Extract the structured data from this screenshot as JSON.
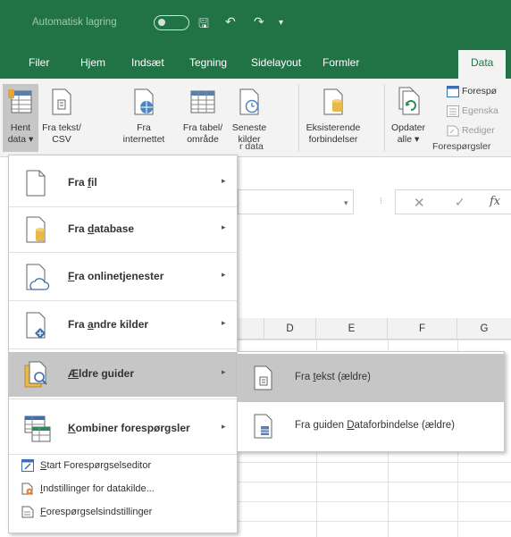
{
  "titlebar": {
    "autosave_label": "Automatisk lagring",
    "save_glyph": "🖫",
    "undo_glyph": "↶",
    "redo_glyph": "↷",
    "more_glyph": "▾"
  },
  "tabs": [
    {
      "label": "Filer"
    },
    {
      "label": "Hjem"
    },
    {
      "label": "Indsæt"
    },
    {
      "label": "Tegning"
    },
    {
      "label": "Sidelayout"
    },
    {
      "label": "Formler"
    },
    {
      "label": "Data"
    }
  ],
  "ribbon": {
    "hent_data": {
      "line1": "Hent",
      "line2": "data ▾"
    },
    "fra_tekst": {
      "line1": "Fra tekst/",
      "line2": "CSV"
    },
    "fra_internettet": {
      "line1": "Fra",
      "line2": "internettet"
    },
    "fra_tabel": {
      "line1": "Fra tabel/",
      "line2": "område"
    },
    "seneste_kilder": {
      "line1": "Seneste",
      "line2": "kilder"
    },
    "eksisterende": {
      "line1": "Eksisterende",
      "line2": "forbindelser"
    },
    "opdater": {
      "line1": "Opdater",
      "line2": "alle ▾"
    },
    "foresp": "Forespø",
    "egenska": "Egenska",
    "rediger": "Rediger",
    "group_data_label": "r data",
    "group_foresp_label": "Forespørgsler"
  },
  "formula_bar": {
    "dropdown": "▾",
    "cancel": "✕",
    "enter": "✓",
    "fx": "fx"
  },
  "columns": [
    "D",
    "E",
    "F",
    "G"
  ],
  "menu": {
    "items": [
      {
        "pre": "Fra ",
        "key": "f",
        "post": "il"
      },
      {
        "pre": "Fra ",
        "key": "d",
        "post": "atabase"
      },
      {
        "pre": "",
        "key": "F",
        "post": "ra onlinetjenester"
      },
      {
        "pre": "Fra ",
        "key": "a",
        "post": "ndre kilder"
      },
      {
        "pre": "",
        "key": "Æ",
        "post": "ldre guider"
      },
      {
        "pre": "",
        "key": "K",
        "post": "ombiner forespørgsler"
      }
    ],
    "small_items": [
      {
        "key": "S",
        "post": "tart Forespørgselseditor"
      },
      {
        "key": "I",
        "post": "ndstillinger for datakilde..."
      },
      {
        "key": "F",
        "post": "orespørgselsindstillinger"
      }
    ],
    "arrow": "▸"
  },
  "submenu": {
    "items": [
      {
        "pre": "Fra ",
        "key": "t",
        "post": "ekst (ældre)"
      },
      {
        "pre": "Fra guiden ",
        "key": "D",
        "post": "ataforbindelse (ældre)"
      }
    ]
  },
  "colors": {
    "excel_green": "#217346",
    "highlight": "#c6c6c6",
    "ribbon_bg": "#f3f3f3"
  }
}
